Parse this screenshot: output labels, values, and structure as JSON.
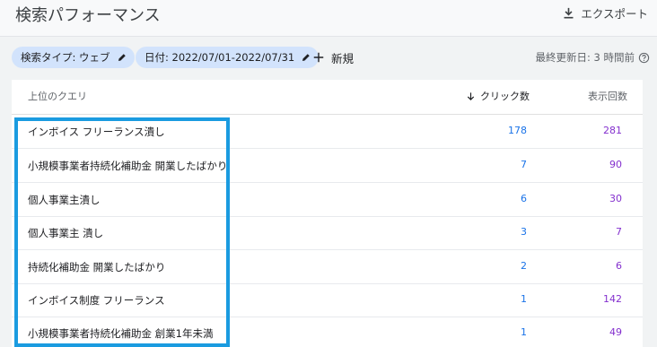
{
  "header": {
    "title": "検索パフォーマンス",
    "export_label": "エクスポート"
  },
  "filters": {
    "search_type": "検索タイプ: ウェブ",
    "date": "日付: 2022/07/01-2022/07/31",
    "new_label": "新規",
    "last_updated": "最終更新日: 3 時間前"
  },
  "table": {
    "headers": {
      "query": "上位のクエリ",
      "clicks": "クリック数",
      "impressions": "表示回数"
    },
    "rows": [
      {
        "query": "インボイス フリーランス潰し",
        "clicks": "178",
        "impressions": "281"
      },
      {
        "query": "小規模事業者持続化補助金 開業したばかり",
        "clicks": "7",
        "impressions": "90"
      },
      {
        "query": "個人事業主潰し",
        "clicks": "6",
        "impressions": "30"
      },
      {
        "query": "個人事業主 潰し",
        "clicks": "3",
        "impressions": "7"
      },
      {
        "query": "持続化補助金 開業したばかり",
        "clicks": "2",
        "impressions": "6"
      },
      {
        "query": "インボイス制度 フリーランス",
        "clicks": "1",
        "impressions": "142"
      },
      {
        "query": "小規模事業者持続化補助金 創業1年未満",
        "clicks": "1",
        "impressions": "49"
      }
    ]
  },
  "colors": {
    "clicks": "#1a73e8",
    "impressions": "#8430ce",
    "highlight": "#1a9be0",
    "chip": "#d2e3fc"
  },
  "icons": {
    "export": "download-icon",
    "edit": "pencil-icon",
    "new": "plus-icon",
    "help": "help-circle-icon",
    "sort": "arrow-down-icon"
  }
}
